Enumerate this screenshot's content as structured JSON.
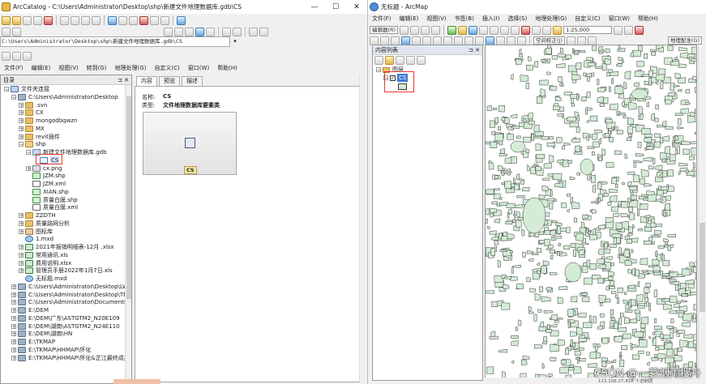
{
  "catalog": {
    "title": "ArcCatalog - C:\\Users\\Administrator\\Desktop\\shp\\新建文件地理数据库.gdb\\CS",
    "address": "C:\\Users\\Administrator\\Desktop\\shp\\新建文件地理数据库.gdb\\CS",
    "menu": [
      "文件(F)",
      "编辑(E)",
      "视图(V)",
      "转到(G)",
      "地理处理(G)",
      "自定义(C)",
      "窗口(W)",
      "帮助(H)"
    ],
    "panel_title": "目录",
    "tree": [
      {
        "label": "文件夹连接",
        "level": 0,
        "icon": "folder-connections",
        "exp": "-"
      },
      {
        "label": "C:\\Users\\Administrator\\Desktop",
        "level": 1,
        "icon": "folder-connection",
        "exp": "-"
      },
      {
        "label": ".svn",
        "level": 2,
        "icon": "folder",
        "exp": "+"
      },
      {
        "label": "CX",
        "level": 2,
        "icon": "folder",
        "exp": "+"
      },
      {
        "label": "mongodbqwzn",
        "level": 2,
        "icon": "folder",
        "exp": "+"
      },
      {
        "label": "MX",
        "level": 2,
        "icon": "folder",
        "exp": "+"
      },
      {
        "label": "revit插件",
        "level": 2,
        "icon": "folder",
        "exp": "+"
      },
      {
        "label": "shp",
        "level": 2,
        "icon": "folder-open",
        "exp": "-"
      },
      {
        "label": "新建文件地理数据库.gdb",
        "level": 3,
        "icon": "gdb",
        "exp": "-"
      },
      {
        "label": "CS",
        "level": 4,
        "icon": "feature-class",
        "exp": ""
      },
      {
        "label": "cx.png",
        "level": 3,
        "icon": "png",
        "exp": "+"
      },
      {
        "label": "JZM.shp",
        "level": 3,
        "icon": "shapefile",
        "exp": ""
      },
      {
        "label": "JZM.xml",
        "level": 3,
        "icon": "xml",
        "exp": ""
      },
      {
        "label": "XIAN.shp",
        "level": 3,
        "icon": "shapefile",
        "exp": ""
      },
      {
        "label": "质量白膜.shp",
        "level": 3,
        "icon": "shapefile",
        "exp": ""
      },
      {
        "label": "质量白膜.xml",
        "level": 3,
        "icon": "xml",
        "exp": ""
      },
      {
        "label": "ZZDTH",
        "level": 2,
        "icon": "folder",
        "exp": "+"
      },
      {
        "label": "质量路网分析",
        "level": 2,
        "icon": "folder",
        "exp": "+"
      },
      {
        "label": "图标库",
        "level": 2,
        "icon": "toolbox",
        "exp": "+"
      },
      {
        "label": "1.mxd",
        "level": 2,
        "icon": "mxd",
        "exp": ""
      },
      {
        "label": "2021年报销明细表-12月 .xlsx",
        "level": 2,
        "icon": "xls",
        "exp": "+"
      },
      {
        "label": "常用通讯.xls",
        "level": 2,
        "icon": "xls",
        "exp": "+"
      },
      {
        "label": "费用说明.xlsx",
        "level": 2,
        "icon": "xls",
        "exp": "+"
      },
      {
        "label": "管理员手册2022年1月7日.xls",
        "level": 2,
        "icon": "xls",
        "exp": "+"
      },
      {
        "label": "无标题.mxd",
        "level": 2,
        "icon": "mxd",
        "exp": ""
      },
      {
        "label": "C:\\Users\\Administrator\\Desktop\\LW",
        "level": 1,
        "icon": "folder-connection",
        "exp": "+"
      },
      {
        "label": "C:\\Users\\Administrator\\Desktop\\TPZ",
        "level": 1,
        "icon": "folder-connection",
        "exp": "+"
      },
      {
        "label": "C:\\Users\\Administrator\\Documents\\A",
        "level": 1,
        "icon": "folder-connection",
        "exp": "+"
      },
      {
        "label": "E:\\DEM",
        "level": 1,
        "icon": "folder-connection",
        "exp": "+"
      },
      {
        "label": "E:\\DEM\\广东\\ASTGTM2_N20E109",
        "level": 1,
        "icon": "folder-connection",
        "exp": "+"
      },
      {
        "label": "E:\\DEM\\湖南\\ASTGTM2_N24E110",
        "level": 1,
        "icon": "folder-connection",
        "exp": "+"
      },
      {
        "label": "E:\\DEM\\湖南\\HN",
        "level": 1,
        "icon": "folder-connection",
        "exp": "+"
      },
      {
        "label": "E:\\TKMAP",
        "level": 1,
        "icon": "folder-connection",
        "exp": "+"
      },
      {
        "label": "E:\\TKMAP\\HHMAP\\怀化",
        "level": 1,
        "icon": "folder-connection",
        "exp": "+"
      },
      {
        "label": "E:\\TKMAP\\HHMAP\\怀化&芷江最终成果",
        "level": 1,
        "icon": "folder-connection",
        "exp": "+"
      }
    ],
    "tabs": [
      "内容",
      "预览",
      "描述"
    ],
    "content": {
      "name_key": "名称:",
      "name_value": "CS",
      "type_key": "类型:",
      "type_value": "文件地理数据库要素类",
      "preview_label": "CS"
    }
  },
  "arcmap": {
    "title": "无标题 - ArcMap",
    "menu": [
      "文件(F)",
      "编辑(E)",
      "视图(V)",
      "书签(B)",
      "插入(I)",
      "选择(S)",
      "地理处理(G)",
      "自定义(C)",
      "窗口(W)",
      "帮助(H)"
    ],
    "editor_label": "编辑器(R)",
    "scale": "1:25,000",
    "spatial_adjustment_label": "空间校正(J)",
    "georef_label": "地理配准(G)",
    "toc_title": "内容列表",
    "layers_group": "图层",
    "layer_name": "CS",
    "layer_checked": true,
    "status_text": "113.106 27.818 十进制度"
  },
  "watermark": "CSDN @一蓑烟雨搜舟",
  "colors": {
    "map_fill": "#d4ecd6",
    "map_stroke": "#3a3a3a",
    "highlight": "#e53935",
    "window_bg": "#f0f0f0"
  }
}
